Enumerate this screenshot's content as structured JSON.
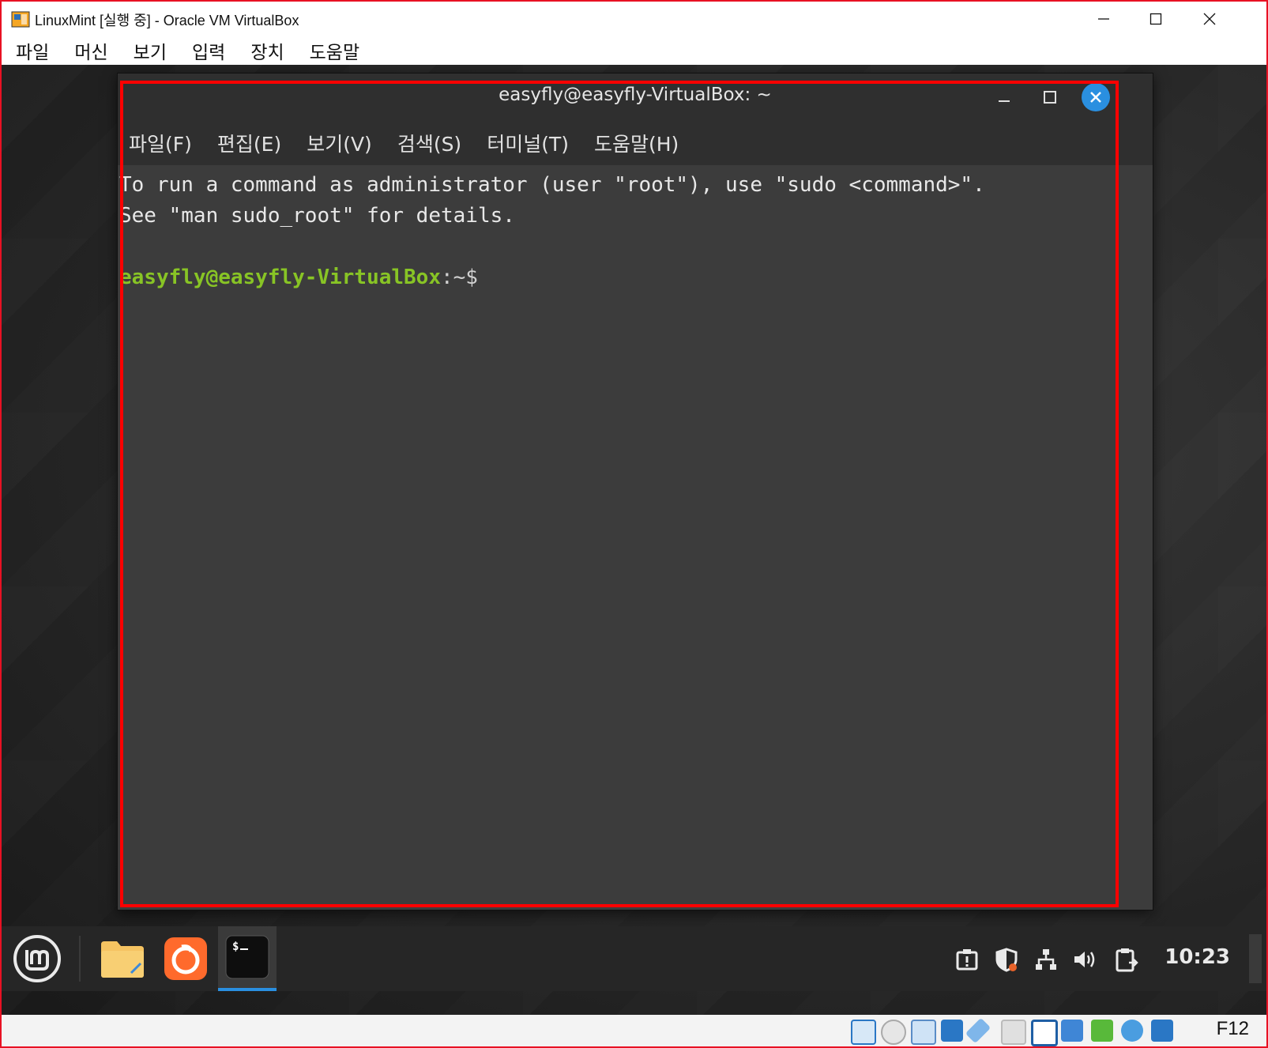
{
  "host": {
    "title": "LinuxMint [실행 중] - Oracle VM VirtualBox",
    "menu": [
      "파일",
      "머신",
      "보기",
      "입력",
      "장치",
      "도움말"
    ],
    "host_key_label": "F12"
  },
  "terminal": {
    "title": "easyfly@easyfly-VirtualBox: ~",
    "menu": [
      "파일(F)",
      "편집(E)",
      "보기(V)",
      "검색(S)",
      "터미널(T)",
      "도움말(H)"
    ],
    "lines": [
      "To run a command as administrator (user \"root\"), use \"sudo <command>\".",
      "See \"man sudo_root\" for details."
    ],
    "prompt_user": "easyfly@easyfly-VirtualBox",
    "prompt_path": ":~$"
  },
  "taskbar": {
    "clock": "10:23",
    "launchers": [
      "menu-icon",
      "files-icon",
      "firefox-icon",
      "terminal-icon"
    ],
    "tray": [
      "update-icon",
      "shield-icon",
      "network-icon",
      "volume-icon",
      "clipboard-icon"
    ]
  },
  "colors": {
    "prompt": "#88c425",
    "highlight": "#ff0000",
    "close_button": "#2a8fe0"
  }
}
